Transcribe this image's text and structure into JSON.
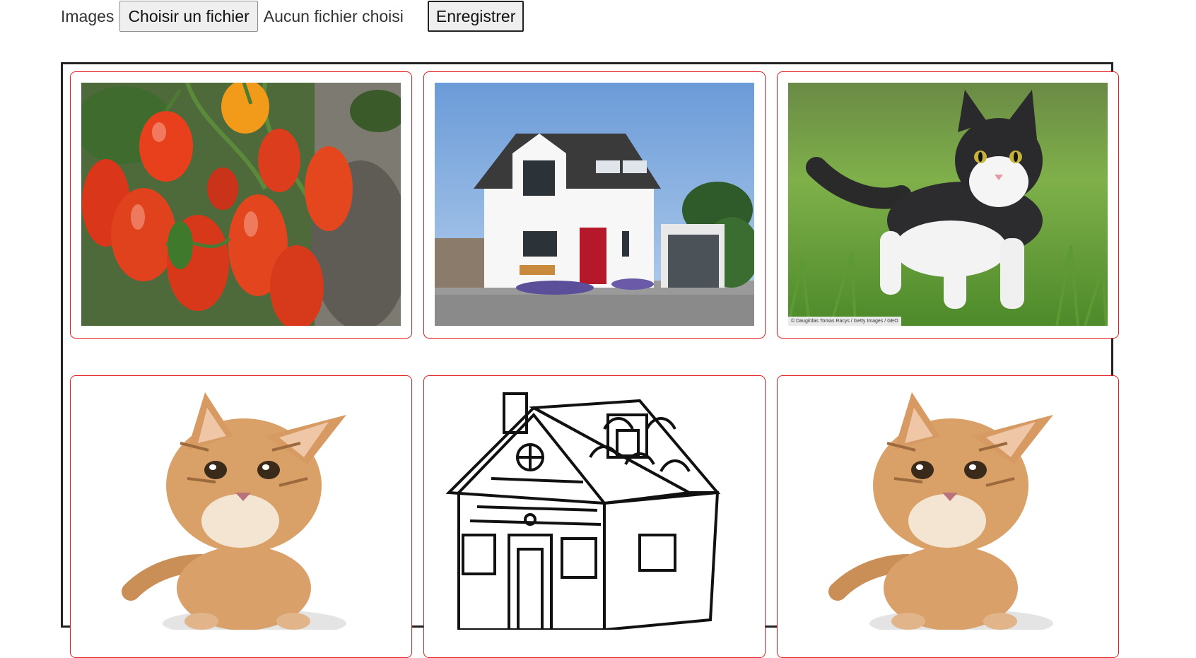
{
  "upload": {
    "label": "Images",
    "choose_button": "Choisir un fichier",
    "file_status": "Aucun fichier choisi",
    "save_button": "Enregistrer"
  },
  "gallery": {
    "border_color": "#e31b1b",
    "items": [
      {
        "subject": "tomatoes-photo"
      },
      {
        "subject": "house-photo"
      },
      {
        "subject": "cat-in-grass-photo",
        "credit": "© Daugirdas Tomas Racys / Getty Images / GEO"
      },
      {
        "subject": "kitten-photo"
      },
      {
        "subject": "house-line-drawing"
      },
      {
        "subject": "kitten-photo"
      }
    ]
  }
}
